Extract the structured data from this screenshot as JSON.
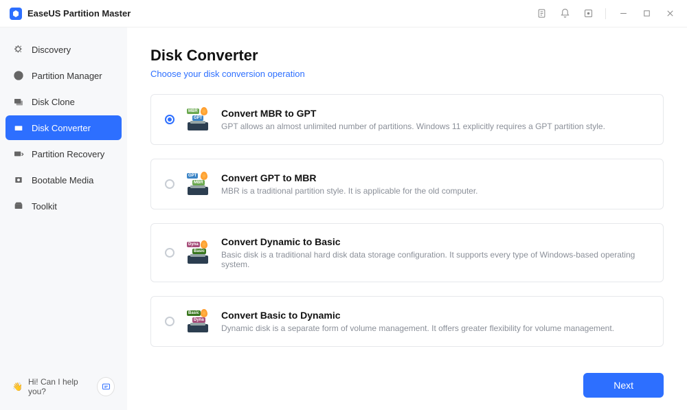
{
  "app_title": "EaseUS Partition Master",
  "sidebar": {
    "items": [
      {
        "label": "Discovery",
        "active": false
      },
      {
        "label": "Partition Manager",
        "active": false
      },
      {
        "label": "Disk Clone",
        "active": false
      },
      {
        "label": "Disk Converter",
        "active": true
      },
      {
        "label": "Partition Recovery",
        "active": false
      },
      {
        "label": "Bootable Media",
        "active": false
      },
      {
        "label": "Toolkit",
        "active": false
      }
    ],
    "help_text": "Hi! Can I help you?",
    "help_emoji": "👋"
  },
  "page": {
    "title": "Disk Converter",
    "subtitle": "Choose your disk conversion operation"
  },
  "options": [
    {
      "title": "Convert MBR to GPT",
      "desc": "GPT allows an almost unlimited number of partitions. Windows 11 explicitly requires a GPT partition style.",
      "selected": true,
      "badge1_text": "MBR",
      "badge1_color": "#6aa84f",
      "badge2_text": "GPT",
      "badge2_color": "#3d85c6"
    },
    {
      "title": "Convert GPT to MBR",
      "desc": "MBR is a traditional partition style. It is applicable for the old computer.",
      "selected": false,
      "badge1_text": "GPT",
      "badge1_color": "#3d85c6",
      "badge2_text": "MBR",
      "badge2_color": "#6aa84f"
    },
    {
      "title": "Convert Dynamic to Basic",
      "desc": "Basic disk is a traditional hard disk data storage configuration. It supports every type of Windows-based operating system.",
      "selected": false,
      "badge1_text": "Dyna",
      "badge1_color": "#a64d79",
      "badge2_text": "Basic",
      "badge2_color": "#38761d"
    },
    {
      "title": "Convert Basic to Dynamic",
      "desc": "Dynamic disk is a separate form of volume management. It offers greater flexibility for volume management.",
      "selected": false,
      "badge1_text": "Basic",
      "badge1_color": "#38761d",
      "badge2_text": "Dyna",
      "badge2_color": "#a64d79"
    }
  ],
  "footer": {
    "next_label": "Next"
  }
}
